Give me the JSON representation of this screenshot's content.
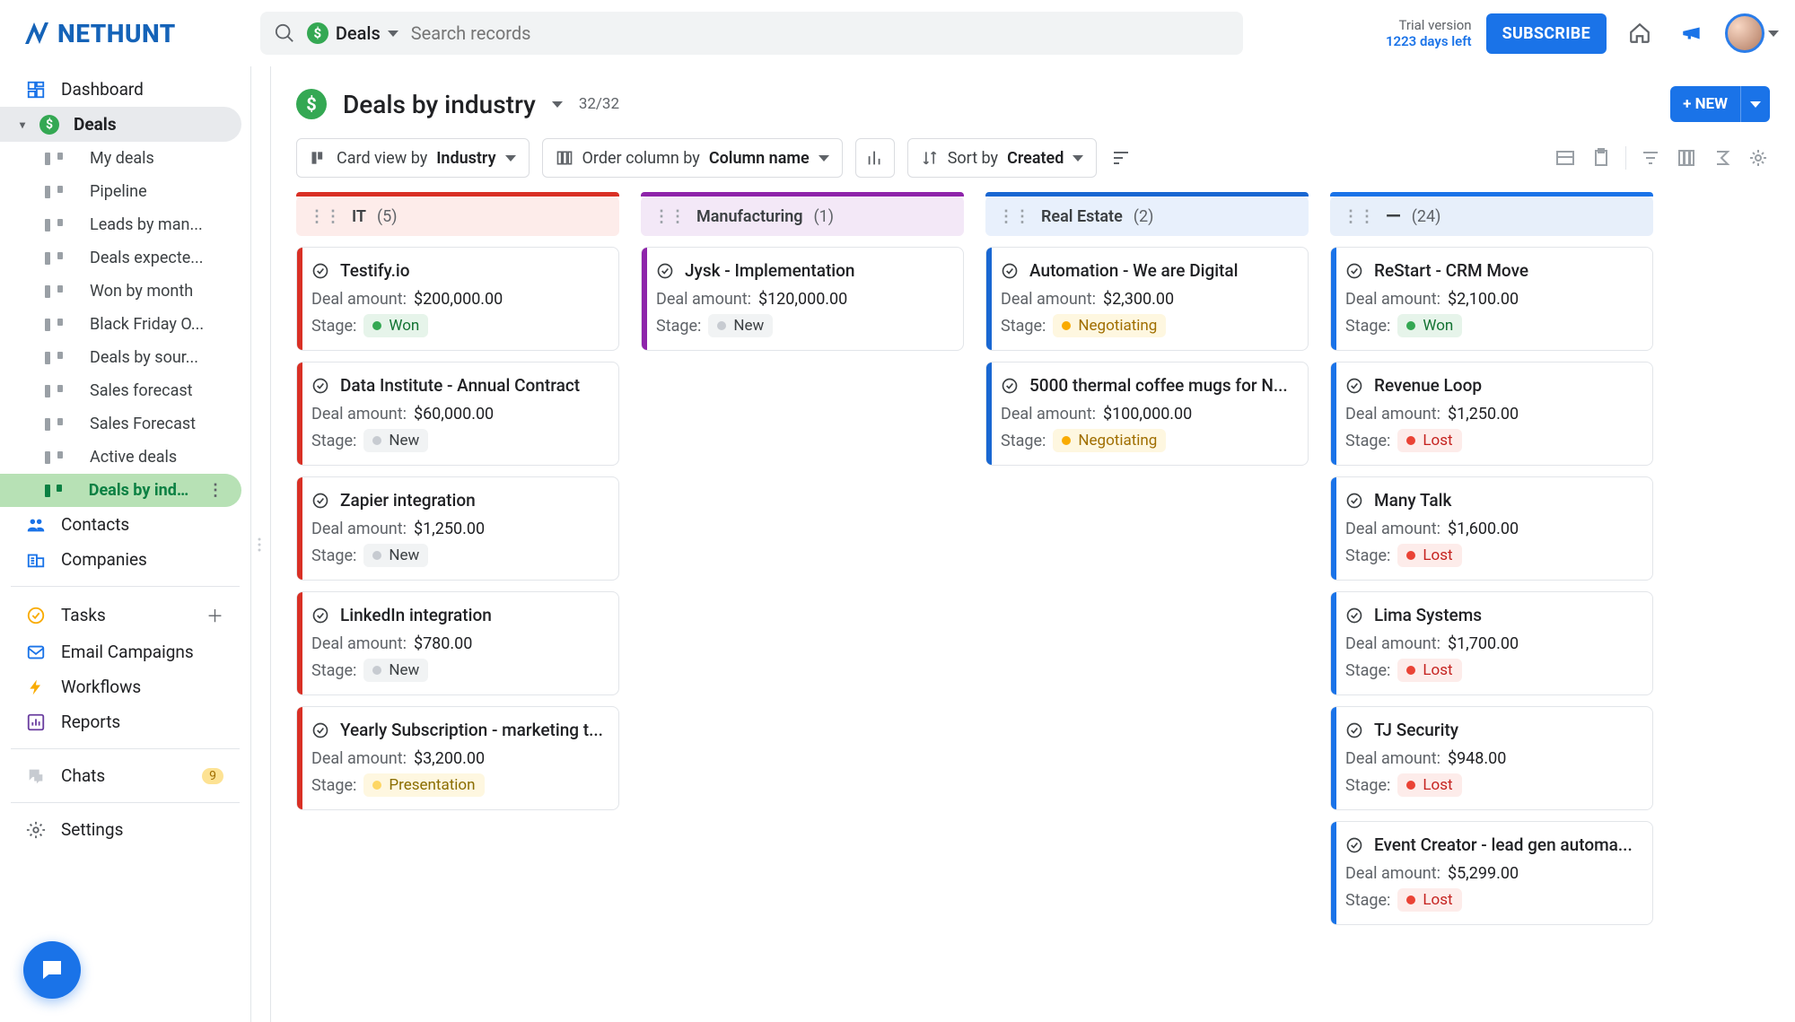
{
  "app": {
    "brand": "NETHUNT"
  },
  "header": {
    "scope_label": "Deals",
    "search_placeholder": "Search records",
    "trial_line1": "Trial version",
    "trial_line2": "1223 days left",
    "subscribe_label": "SUBSCRIBE"
  },
  "sidebar": {
    "dashboard": "Dashboard",
    "deals": "Deals",
    "views": [
      "My deals",
      "Pipeline",
      "Leads by man...",
      "Deals expecte...",
      "Won by month",
      "Black Friday O...",
      "Deals by sour...",
      "Sales forecast",
      "Sales Forecast",
      "Active deals",
      "Deals by indu..."
    ],
    "selected_view_index": 10,
    "contacts": "Contacts",
    "companies": "Companies",
    "tasks": "Tasks",
    "email": "Email Campaigns",
    "workflows": "Workflows",
    "reports": "Reports",
    "chats": "Chats",
    "chats_badge": "9",
    "settings": "Settings"
  },
  "view": {
    "title": "Deals by industry",
    "count": "32/32",
    "new_button": "+ NEW"
  },
  "toolbar": {
    "cardview_prefix": "Card view by",
    "cardview_field": "Industry",
    "order_prefix": "Order column by",
    "order_field": "Column name",
    "sort_prefix": "Sort by",
    "sort_field": "Created"
  },
  "board": {
    "columns": [
      {
        "key": "it",
        "title": "IT",
        "count": "(5)",
        "stripe": "#d93025",
        "cards": [
          {
            "title": "Testify.io",
            "amount": "$200,000.00",
            "stage": "Won"
          },
          {
            "title": "Data Institute - Annual Contract",
            "amount": "$60,000.00",
            "stage": "New"
          },
          {
            "title": "Zapier integration",
            "amount": "$1,250.00",
            "stage": "New"
          },
          {
            "title": "LinkedIn integration",
            "amount": "$780.00",
            "stage": "New"
          },
          {
            "title": "Yearly Subscription - marketing t...",
            "amount": "$3,200.00",
            "stage": "Presentation"
          }
        ]
      },
      {
        "key": "mf",
        "title": "Manufacturing",
        "count": "(1)",
        "stripe": "#8e24aa",
        "cards": [
          {
            "title": "Jysk - Implementation",
            "amount": "$120,000.00",
            "stage": "New"
          }
        ]
      },
      {
        "key": "re",
        "title": "Real Estate",
        "count": "(2)",
        "stripe": "#1967d2",
        "cards": [
          {
            "title": "Automation - We are Digital",
            "amount": "$2,300.00",
            "stage": "Negotiating"
          },
          {
            "title": "5000 thermal coffee mugs for N...",
            "amount": "$100,000.00",
            "stage": "Negotiating"
          }
        ]
      },
      {
        "key": "un",
        "title": "—",
        "count": "(24)",
        "stripe": "#1a73e8",
        "cards": [
          {
            "title": "ReStart - CRM Move",
            "amount": "$2,100.00",
            "stage": "Won"
          },
          {
            "title": "Revenue Loop",
            "amount": "$1,250.00",
            "stage": "Lost"
          },
          {
            "title": "Many Talk",
            "amount": "$1,600.00",
            "stage": "Lost"
          },
          {
            "title": "Lima Systems",
            "amount": "$1,700.00",
            "stage": "Lost"
          },
          {
            "title": "TJ Security",
            "amount": "$948.00",
            "stage": "Lost"
          },
          {
            "title": "Event Creator - lead gen automa...",
            "amount": "$5,299.00",
            "stage": "Lost"
          }
        ]
      }
    ],
    "labels": {
      "amount": "Deal amount:",
      "stage": "Stage:"
    }
  }
}
